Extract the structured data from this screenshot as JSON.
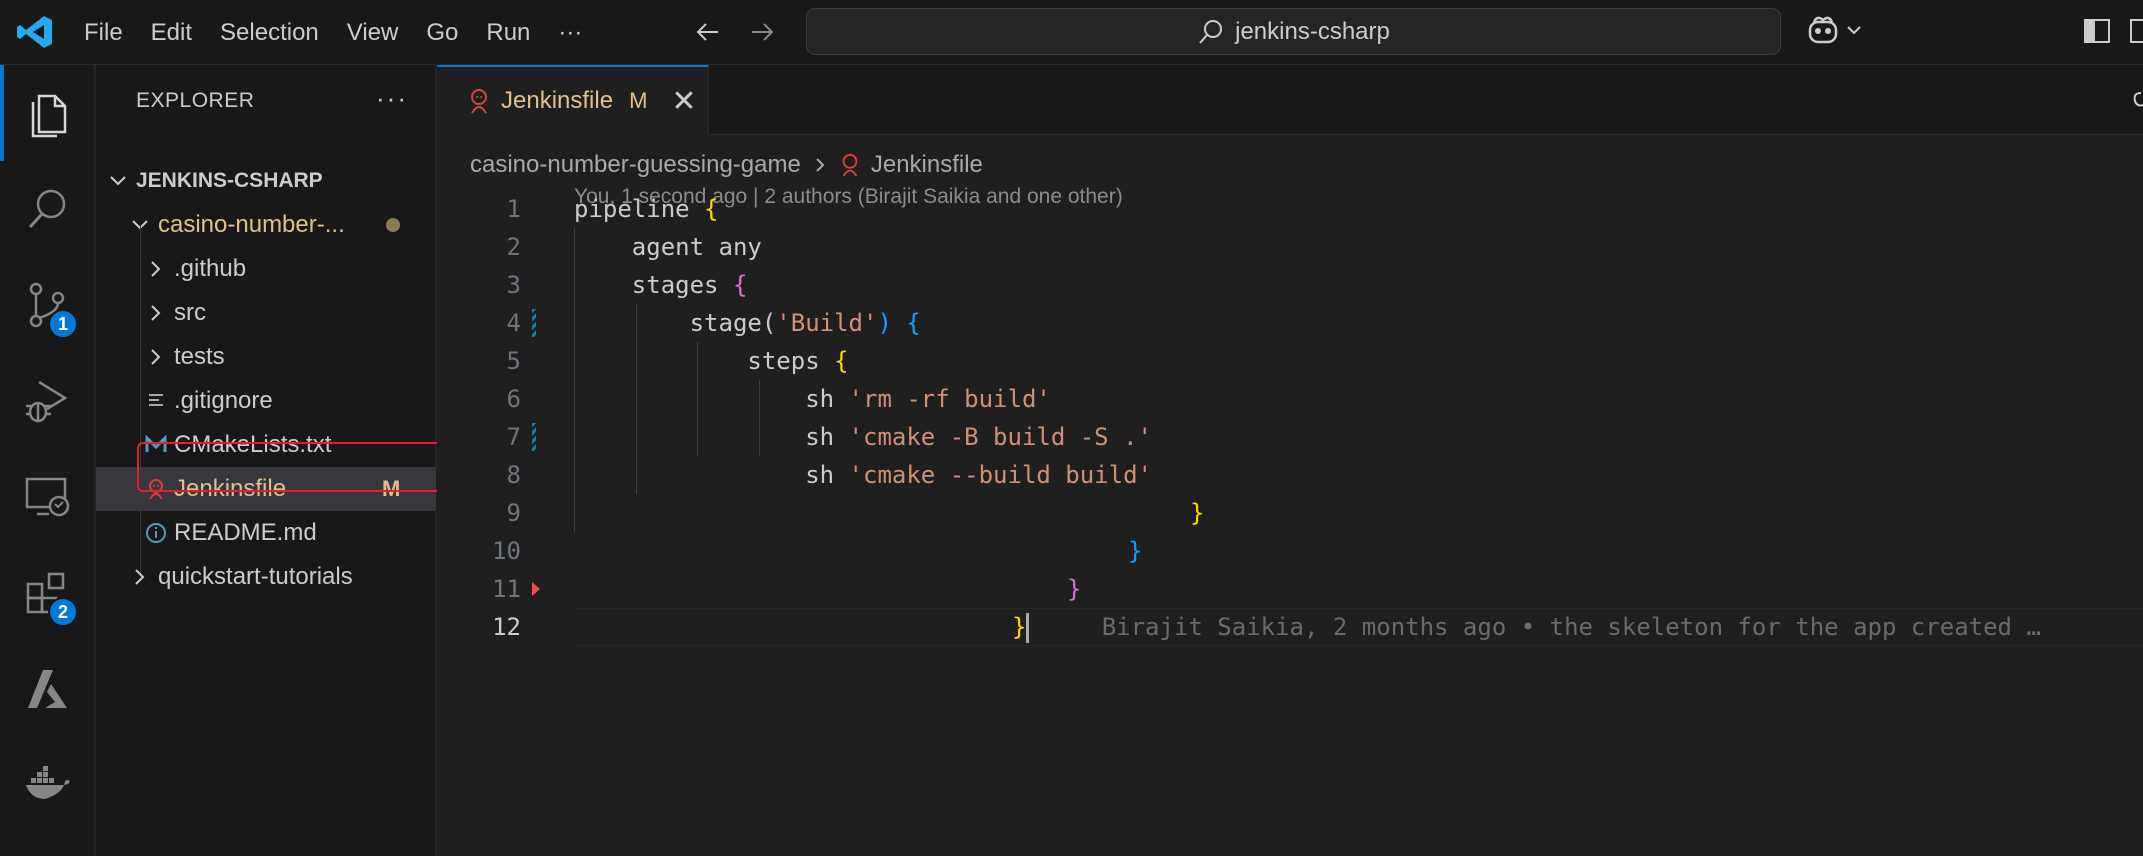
{
  "titlebar": {
    "menu": [
      "File",
      "Edit",
      "Selection",
      "View",
      "Go",
      "Run",
      "···"
    ],
    "search_text": "jenkins-csharp"
  },
  "activity": {
    "source_control_badge": "1",
    "extensions_badge": "2"
  },
  "explorer": {
    "header": "EXPLORER",
    "more": "···",
    "root": "JENKINS-CSHARP",
    "items": [
      {
        "label": "casino-number-...",
        "type": "folder-open",
        "modified": true
      },
      {
        "label": ".github",
        "type": "folder"
      },
      {
        "label": "src",
        "type": "folder"
      },
      {
        "label": "tests",
        "type": "folder"
      },
      {
        "label": ".gitignore",
        "type": "file"
      },
      {
        "label": "CMakeLists.txt",
        "type": "file"
      },
      {
        "label": "Jenkinsfile",
        "type": "file",
        "status": "M"
      },
      {
        "label": "README.md",
        "type": "file"
      },
      {
        "label": "quickstart-tutorials",
        "type": "folder"
      }
    ]
  },
  "editor": {
    "tab": {
      "name": "Jenkinsfile",
      "status": "M",
      "close": "✕"
    },
    "breadcrumb": [
      "casino-number-guessing-game",
      "Jenkinsfile"
    ],
    "blame_header": "You, 1 second ago | 2 authors (Birajit Saikia and one other)",
    "lines": [
      "1",
      "2",
      "3",
      "4",
      "5",
      "6",
      "7",
      "8",
      "9",
      "10",
      "11",
      "12"
    ],
    "code": {
      "l1": "pipeline ",
      "l2": "    agent any",
      "l3": "    stages ",
      "l4a": "        stage(",
      "l4b": "'Build'",
      "l4c": ") ",
      "l5": "            steps ",
      "l6a": "                sh ",
      "l6b": "'rm -rf build'",
      "l7a": "                sh ",
      "l7b": "'cmake -B build -S .'",
      "l8a": "                sh ",
      "l8b": "'cmake --build build'",
      "brace_open": "{",
      "brace_close": "}",
      "paren_open": "(",
      "paren_close": ")"
    },
    "blame_inline": "Birajit Saikia, 2 months ago • the skeleton for the app created …"
  }
}
